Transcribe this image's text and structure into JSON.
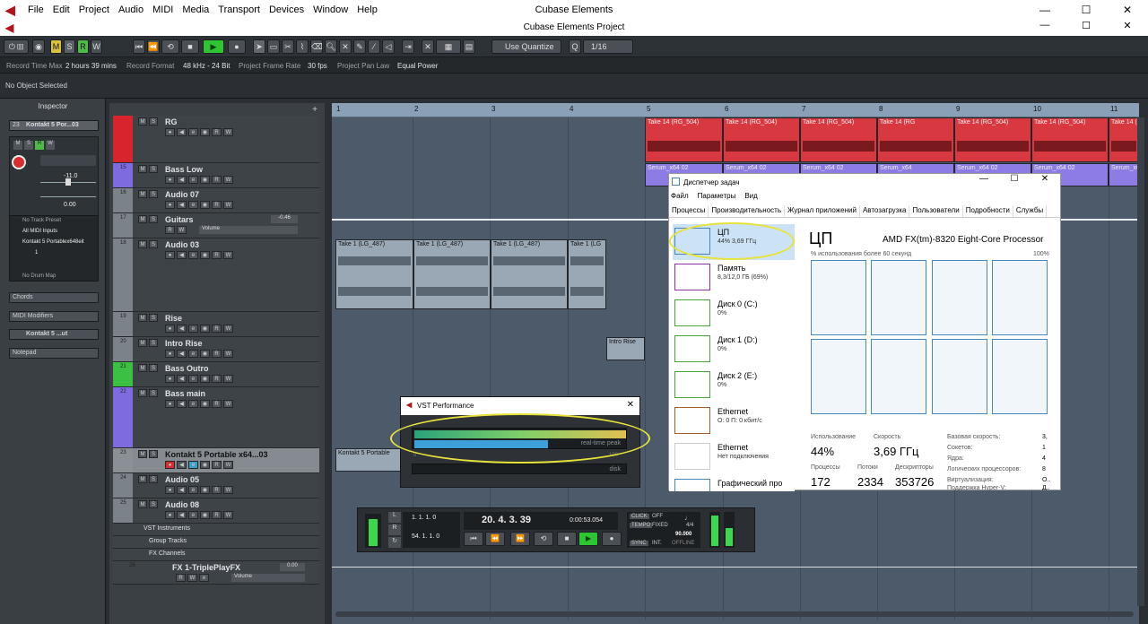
{
  "app": {
    "menu_items": [
      "File",
      "Edit",
      "Project",
      "Audio",
      "MIDI",
      "Media",
      "Transport",
      "Devices",
      "Window",
      "Help"
    ],
    "window_title": "Cubase Elements",
    "project_title": "Cubase Elements Project"
  },
  "toolbar": {
    "mode_buttons": [
      "M",
      "S",
      "R",
      "W"
    ],
    "quantize_mode": "Use Quantize",
    "quantize_value": "1/16"
  },
  "status": {
    "record_time_max_label": "Record Time Max",
    "record_time_max_value": "2 hours 39 mins",
    "record_format_label": "Record Format",
    "record_format_value": "48 kHz - 24 Bit",
    "frame_rate_label": "Project Frame Rate",
    "frame_rate_value": "30 fps",
    "pan_law_label": "Project Pan Law",
    "pan_law_value": "Equal Power"
  },
  "info_line": "No Object Selected",
  "inspector": {
    "title": "Inspector",
    "track_number": "23",
    "track_name": "Kontakt 5 Por...03",
    "volume_value": "-11.0",
    "pan_value": "0.00",
    "no_track_preset": "No Track Preset",
    "midi_inputs": "All MIDI Inputs",
    "output": "Kontakt 5 Portablex648eit",
    "channel": "1",
    "no_drum_map": "No Drum Map",
    "sections": [
      "Chords",
      "MIDI Modifiers",
      "Kontakt 5 ...ut",
      "Notepad"
    ]
  },
  "tracks": [
    {
      "num": "",
      "name": "RG",
      "color": "#d8242c"
    },
    {
      "num": "15",
      "name": "Bass Low",
      "color": "#7e6be0"
    },
    {
      "num": "16",
      "name": "Audio 07",
      "color": "#7c828a"
    },
    {
      "num": "17",
      "name": "Guitars",
      "value": "-0.46",
      "extra": "Volume",
      "color": "#7c828a"
    },
    {
      "num": "18",
      "name": "Audio 03",
      "color": "#7c828a"
    },
    {
      "num": "19",
      "name": "Rise",
      "color": "#7c828a"
    },
    {
      "num": "20",
      "name": "Intro Rise",
      "color": "#7c828a"
    },
    {
      "num": "21",
      "name": "Bass Outro",
      "color": "#3cc043"
    },
    {
      "num": "22",
      "name": "Bass main",
      "color": "#7e6be0"
    },
    {
      "num": "23",
      "name": "Kontakt 5 Portable x64...03",
      "color": "#8a9096"
    },
    {
      "num": "24",
      "name": "Audio 05",
      "color": "#7c828a"
    },
    {
      "num": "25",
      "name": "Audio 08",
      "color": "#7c828a"
    }
  ],
  "folders": [
    "VST Instruments",
    "Group Tracks",
    "FX Channels"
  ],
  "fx_track": {
    "num": "26",
    "name": "FX 1-TriplePlayFX",
    "value": "0.00",
    "extra": "Volume"
  },
  "ruler": [
    "1",
    "2",
    "3",
    "4",
    "5",
    "6",
    "7",
    "8",
    "9",
    "10",
    "11"
  ],
  "events": {
    "rg_take": "Take 14 (RG_504)",
    "rg_take_short": "Take 14 (RG",
    "serum": "Serum_x64 02",
    "serum_short": "Serum_x64",
    "audio03_take": "Take 1 (LG_487)",
    "audio03_short": "Take 1 (LG",
    "intro_rise": "Intro Rise",
    "kontakt": "Kontakt 5 Portable"
  },
  "task_manager": {
    "title": "Диспетчер задач",
    "menu": [
      "Файл",
      "Параметры",
      "Вид"
    ],
    "tabs": [
      "Процессы",
      "Производительность",
      "Журнал приложений",
      "Автозагрузка",
      "Пользователи",
      "Подробности",
      "Службы"
    ],
    "side": [
      {
        "name": "ЦП",
        "sub": "44% 3,69 ГГц"
      },
      {
        "name": "Память",
        "sub": "8,3/12,0 ГБ (69%)"
      },
      {
        "name": "Диск 0 (C:)",
        "sub": "0%"
      },
      {
        "name": "Диск 1 (D:)",
        "sub": "0%"
      },
      {
        "name": "Диск 2 (E:)",
        "sub": "0%"
      },
      {
        "name": "Ethernet",
        "sub": "О: 0 П: 0 кбит/с"
      },
      {
        "name": "Ethernet",
        "sub": "Нет подключения"
      },
      {
        "name": "Графический про",
        "sub": ""
      }
    ],
    "cpu_header": "ЦП",
    "cpu_model": "AMD FX(tm)-8320 Eight-Core Processor",
    "graph_label": "% использования более 60 секунд",
    "graph_max": "100%",
    "usage_label": "Использование",
    "usage_value": "44%",
    "speed_label": "Скорость",
    "speed_value": "3,69 ГГц",
    "processes_label": "Процессы",
    "processes_value": "172",
    "threads_label": "Потоки",
    "threads_value": "2334",
    "handles_label": "Дескрипторы",
    "handles_value": "353726",
    "details": [
      {
        "k": "Базовая скорость:",
        "v": "3,"
      },
      {
        "k": "Сокетов:",
        "v": "1"
      },
      {
        "k": "Ядра:",
        "v": "4"
      },
      {
        "k": "Логических процессоров:",
        "v": "8"
      },
      {
        "k": "Виртуализация:",
        "v": "О.."
      },
      {
        "k": "Поддержка Hyper-V:",
        "v": "Д.."
      }
    ]
  },
  "vst_performance": {
    "title": "VST Performance",
    "label_peak": "real-time peak",
    "label_disk": "disk",
    "scale_min": "0",
    "scale_max": "100",
    "realtime_fraction": 0.63
  },
  "transport": {
    "pos_left": "1. 1. 1. 0",
    "pos_right": "54. 1. 1. 0",
    "bars": "20. 4. 3. 39",
    "time": "0:00:53.054",
    "click_label": "CLICK",
    "click_value": "OFF",
    "tempo_label": "TEMPO",
    "tempo_mode": "FIXED",
    "signature": "4/4",
    "tempo_value": "90.000",
    "sync_label": "SYNC",
    "sync_value": "INT.",
    "sync_state": "OFFLINE"
  }
}
